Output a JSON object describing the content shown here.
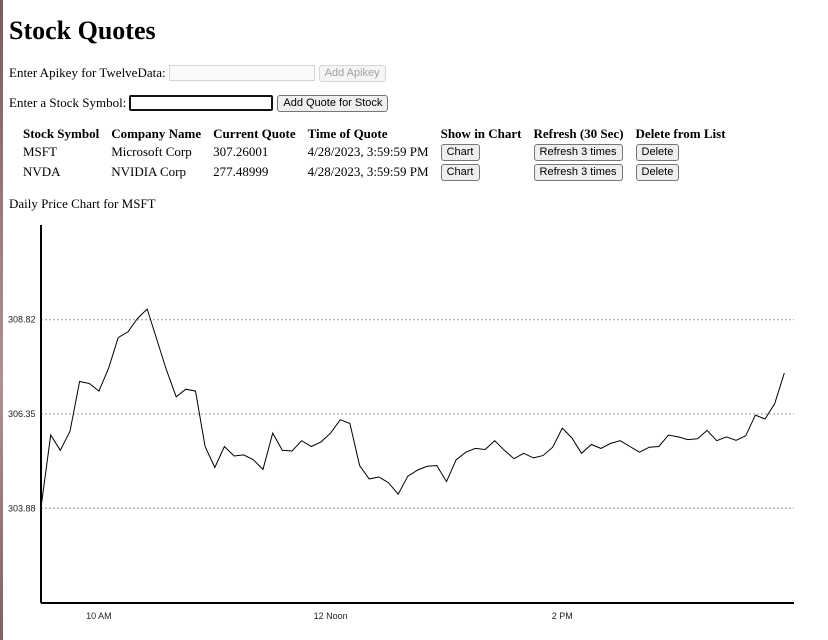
{
  "page": {
    "title": "Stock Quotes",
    "apikey_label": "Enter Apikey for TwelveData:",
    "apikey_value": "",
    "apikey_button": "Add Apikey",
    "symbol_label": "Enter a Stock Symbol:",
    "symbol_value": "",
    "symbol_button": "Add Quote for Stock"
  },
  "table": {
    "headers": [
      "Stock Symbol",
      "Company Name",
      "Current Quote",
      "Time of Quote",
      "Show in Chart",
      "Refresh (30 Sec)",
      "Delete from List"
    ],
    "rows": [
      {
        "symbol": "MSFT",
        "company": "Microsoft Corp",
        "quote": "307.26001",
        "time": "4/28/2023, 3:59:59 PM",
        "chart_label": "Chart",
        "refresh_label": "Refresh 3 times",
        "delete_label": "Delete"
      },
      {
        "symbol": "NVDA",
        "company": "NVIDIA Corp",
        "quote": "277.48999",
        "time": "4/28/2023, 3:59:59 PM",
        "chart_label": "Chart",
        "refresh_label": "Refresh 3 times",
        "delete_label": "Delete"
      }
    ]
  },
  "chart_heading": "Daily Price Chart for MSFT",
  "chart_data": {
    "type": "line",
    "title": "",
    "xlabel": "",
    "ylabel": "",
    "ylim": [
      301.4,
      311.3
    ],
    "y_ticks": [
      303.88,
      306.35,
      308.82
    ],
    "x_range_minutes": [
      570,
      960
    ],
    "x_ticks": [
      {
        "label": "10 AM",
        "value": 600
      },
      {
        "label": "12 Noon",
        "value": 720
      },
      {
        "label": "2 PM",
        "value": 840
      }
    ],
    "grid": "horizontal-dotted",
    "line_color": "#000000",
    "x": [
      570,
      575,
      580,
      585,
      590,
      595,
      600,
      605,
      610,
      615,
      620,
      625,
      630,
      635,
      640,
      645,
      650,
      655,
      660,
      665,
      670,
      675,
      680,
      685,
      690,
      695,
      700,
      705,
      710,
      715,
      720,
      725,
      730,
      735,
      740,
      745,
      750,
      755,
      760,
      765,
      770,
      775,
      780,
      785,
      790,
      795,
      800,
      805,
      810,
      815,
      820,
      825,
      830,
      835,
      840,
      845,
      850,
      855,
      860,
      865,
      870,
      875,
      880,
      885,
      890,
      895,
      900,
      905,
      910,
      915,
      920,
      925,
      930,
      935,
      940,
      945,
      950,
      955
    ],
    "values": [
      303.9,
      305.8,
      305.4,
      305.9,
      307.2,
      307.15,
      306.95,
      307.55,
      308.35,
      308.5,
      308.85,
      309.1,
      308.3,
      307.5,
      306.8,
      307.0,
      306.95,
      305.5,
      304.95,
      305.5,
      305.25,
      305.28,
      305.15,
      304.9,
      305.85,
      305.4,
      305.38,
      305.65,
      305.5,
      305.62,
      305.85,
      306.2,
      306.1,
      305.0,
      304.65,
      304.7,
      304.55,
      304.25,
      304.72,
      304.88,
      304.98,
      305.0,
      304.58,
      305.15,
      305.35,
      305.45,
      305.42,
      305.65,
      305.4,
      305.18,
      305.32,
      305.2,
      305.26,
      305.48,
      305.98,
      305.72,
      305.32,
      305.55,
      305.45,
      305.58,
      305.65,
      305.5,
      305.35,
      305.48,
      305.5,
      305.8,
      305.75,
      305.68,
      305.7,
      305.92,
      305.65,
      305.75,
      305.66,
      305.78,
      306.32,
      306.22,
      306.62,
      307.42
    ]
  }
}
